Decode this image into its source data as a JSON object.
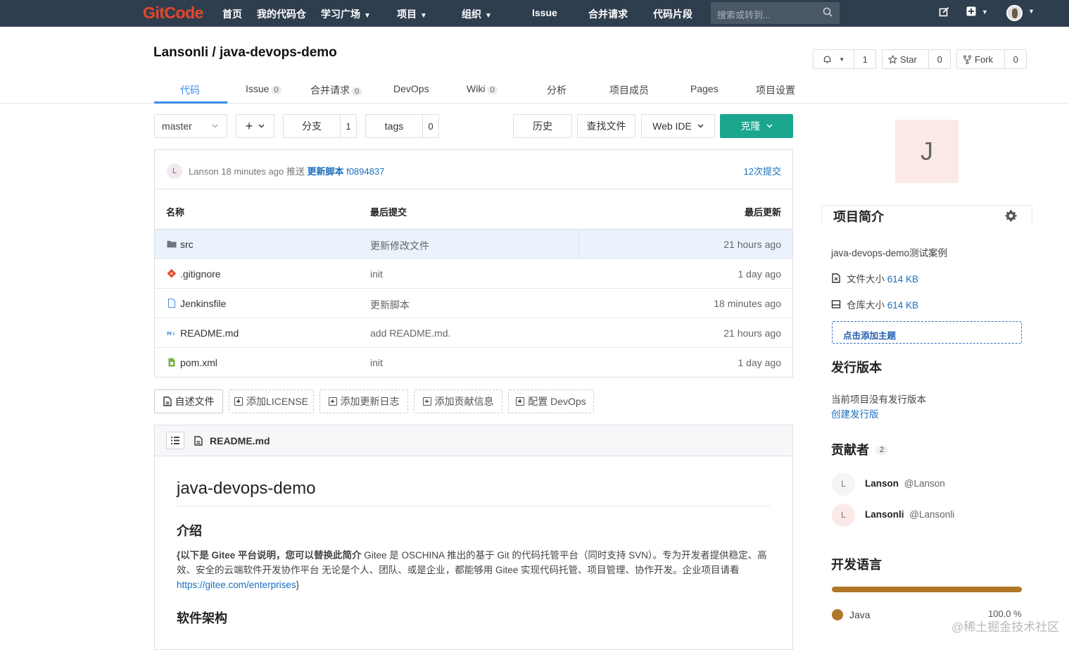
{
  "nav": {
    "logo": "GitCode",
    "items": [
      "首页",
      "我的代码仓",
      "学习广场",
      "项目",
      "组织",
      "Issue",
      "合并请求",
      "代码片段"
    ],
    "search_placeholder": "搜索或转到..."
  },
  "repo": {
    "title": "Lansonli / java-devops-demo",
    "watch_count": "1",
    "star_label": "Star",
    "star_count": "0",
    "fork_label": "Fork",
    "fork_count": "0"
  },
  "tabs": [
    {
      "label": "代码",
      "badge": ""
    },
    {
      "label": "Issue",
      "badge": "0"
    },
    {
      "label": "合并请求",
      "badge": "0"
    },
    {
      "label": "DevOps",
      "badge": ""
    },
    {
      "label": "Wiki",
      "badge": "0"
    },
    {
      "label": "分析",
      "badge": ""
    },
    {
      "label": "项目成员",
      "badge": ""
    },
    {
      "label": "Pages",
      "badge": ""
    },
    {
      "label": "项目设置",
      "badge": ""
    }
  ],
  "toolbar": {
    "branch": "master",
    "add": "+",
    "branches_label": "分支",
    "branches_count": "1",
    "tags_label": "tags",
    "tags_count": "0",
    "history": "历史",
    "find_file": "查找文件",
    "web_ide": "Web IDE",
    "clone": "克隆"
  },
  "commit": {
    "avatar": "L",
    "author": "Lanson",
    "time": "18 minutes ago",
    "action": "推送",
    "message": "更新脚本",
    "sha": "f0894837",
    "count": "12次提交"
  },
  "table": {
    "headers": [
      "名称",
      "最后提交",
      "最后更新"
    ],
    "rows": [
      {
        "name": "src",
        "msg": "更新修改文件",
        "time": "21 hours ago",
        "icon": "folder-icon"
      },
      {
        "name": ".gitignore",
        "msg": "init",
        "time": "1 day ago",
        "icon": "git-icon"
      },
      {
        "name": "Jenkinsfile",
        "msg": "更新脚本",
        "time": "18 minutes ago",
        "icon": "file-icon"
      },
      {
        "name": "README.md",
        "msg": "add README.md.",
        "time": "21 hours ago",
        "icon": "markdown-icon"
      },
      {
        "name": "pom.xml",
        "msg": "init",
        "time": "1 day ago",
        "icon": "xml-file-icon"
      }
    ]
  },
  "actions": [
    "自述文件",
    "添加LICENSE",
    "添加更新日志",
    "添加贡献信息",
    "配置 DevOps"
  ],
  "readme": {
    "filename": "README.md",
    "h1": "java-devops-demo",
    "h2_intro": "介绍",
    "p_bold": "{以下是 Gitee 平台说明，您可以替换此简介",
    "p_text": " Gitee 是 OSCHINA 推出的基于 Git 的代码托管平台（同时支持 SVN）。专为开发者提供稳定、高效、安全的云端软件开发协作平台 无论是个人、团队、或是企业，都能够用 Gitee 实现代码托管、项目管理、协作开发。企业项目请看 ",
    "p_link": "https://gitee.com/enterprises",
    "p_end": "}",
    "h2_arch": "软件架构"
  },
  "sidebar": {
    "avatar": "J",
    "intro_title": "项目简介",
    "description": "java-devops-demo测试案例",
    "file_size_label": "文件大小",
    "file_size": "614 KB",
    "repo_size_label": "仓库大小",
    "repo_size": "614 KB",
    "add_topic": "点击添加主题",
    "releases_title": "发行版本",
    "no_release": "当前项目没有发行版本",
    "create_release": "创建发行版",
    "contributors_title": "贡献者",
    "contributors_count": "2",
    "contributors": [
      {
        "avatar": "L",
        "name": "Lanson",
        "handle": "@Lanson"
      },
      {
        "avatar": "L",
        "name": "Lansonli",
        "handle": "@Lansonli"
      }
    ],
    "languages_title": "开发语言",
    "language": "Java",
    "language_pct": "100.0 %",
    "language_color": "#b0762a"
  },
  "watermark": "@稀土掘金技术社区"
}
